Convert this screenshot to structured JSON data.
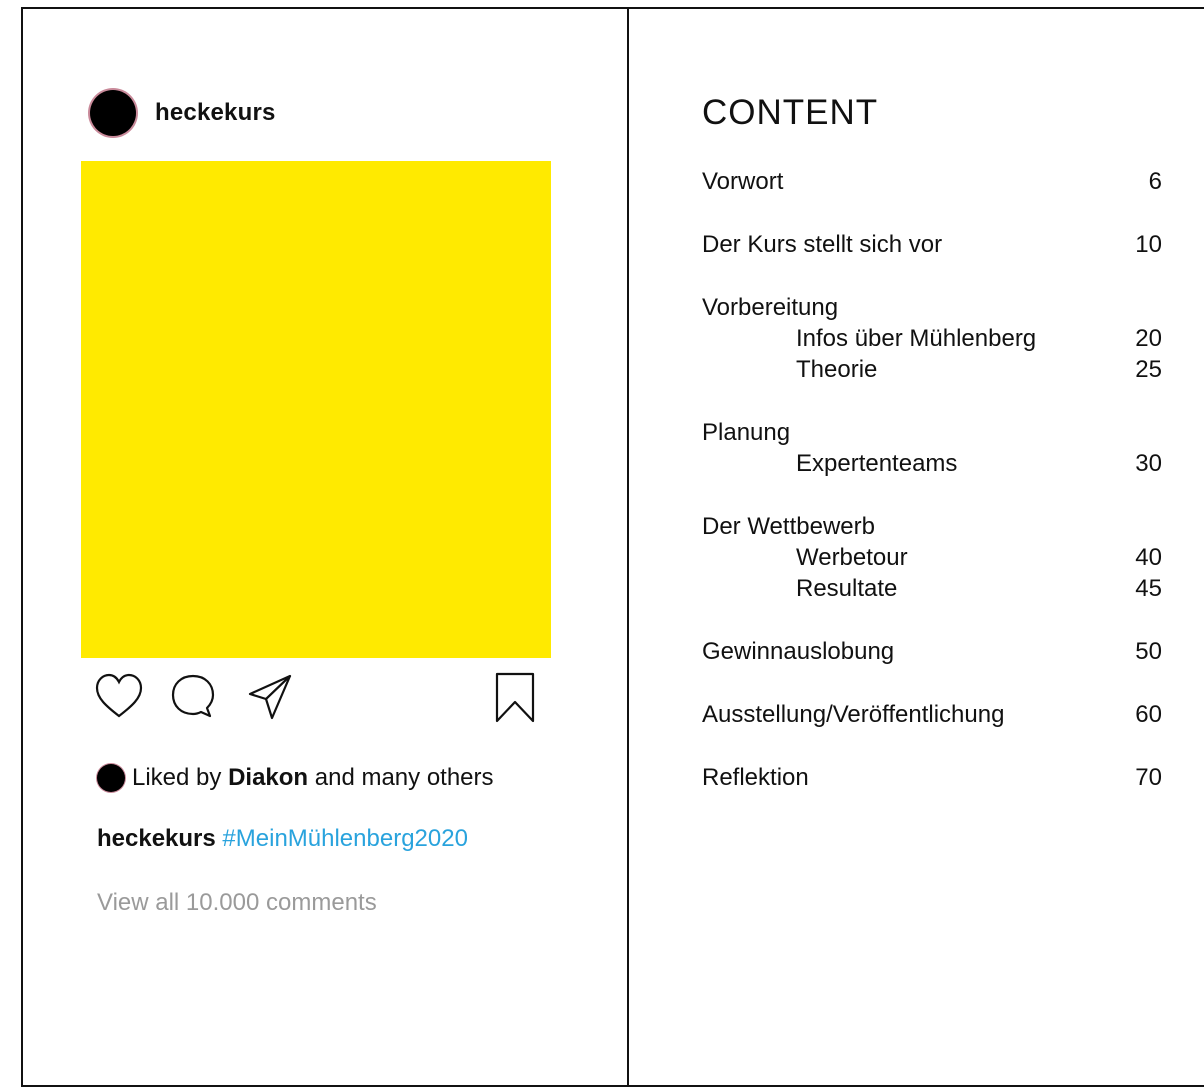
{
  "post": {
    "username": "heckekurs",
    "image_color": "#FFEA00",
    "icons": [
      "heart-icon",
      "comment-icon",
      "share-icon",
      "bookmark-icon"
    ],
    "likes": {
      "prefix": "Liked by",
      "user": "Diakon",
      "suffix": "and many others"
    },
    "caption": {
      "user": "heckekurs",
      "hashtag": "#MeinMühlenberg2020"
    },
    "comments_link": "View all 10.000 comments"
  },
  "toc": {
    "title": "CONTENT",
    "entries": [
      {
        "label": "Vorwort",
        "page": "6"
      },
      {
        "label": "Der Kurs stellt sich vor",
        "page": "10"
      },
      {
        "label": "Vorbereitung",
        "page": ""
      },
      {
        "label": "Infos über Mühlenberg",
        "page": "20"
      },
      {
        "label": "Theorie",
        "page": "25"
      },
      {
        "label": "Planung",
        "page": ""
      },
      {
        "label": "Expertenteams",
        "page": "30"
      },
      {
        "label": "Der Wettbewerb",
        "page": ""
      },
      {
        "label": "Werbetour",
        "page": "40"
      },
      {
        "label": "Resultate",
        "page": "45"
      },
      {
        "label": "Gewinnauslobung",
        "page": "50"
      },
      {
        "label": "Ausstellung/Veröffentlichung",
        "page": "60"
      },
      {
        "label": "Reflektion",
        "page": "70"
      }
    ]
  }
}
